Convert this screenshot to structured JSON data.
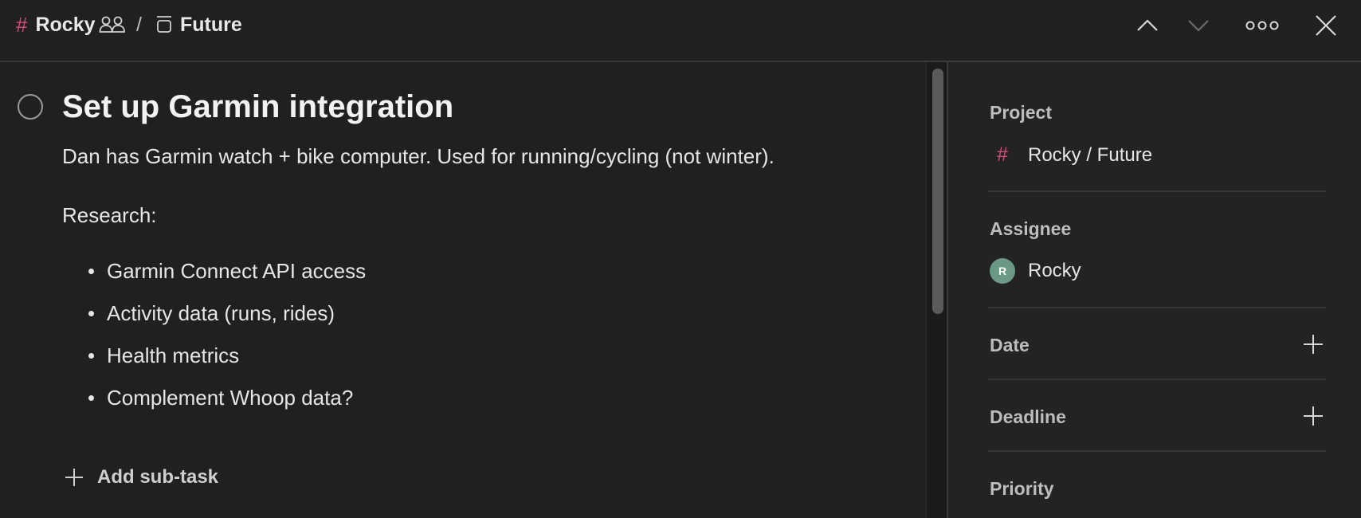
{
  "header": {
    "project_hash": "#",
    "project_name": "Rocky",
    "separator": "/",
    "section_name": "Future",
    "icons": [
      "shared-people-icon",
      "section-icon",
      "chevron-up-icon",
      "chevron-down-icon",
      "more-icon",
      "close-icon"
    ]
  },
  "task": {
    "title": "Set up Garmin integration",
    "description": "Dan has Garmin watch + bike computer. Used for running/cycling (not winter).",
    "research_label": "Research:",
    "bullets": [
      "Garmin Connect API access",
      "Activity data (runs, rides)",
      "Health metrics",
      "Complement Whoop data?"
    ],
    "add_subtask_label": "Add sub-task"
  },
  "sidebar": {
    "project_label": "Project",
    "project_hash": "#",
    "project_value": "Rocky / Future",
    "assignee_label": "Assignee",
    "assignee_initial": "R",
    "assignee_name": "Rocky",
    "date_label": "Date",
    "deadline_label": "Deadline",
    "priority_label": "Priority"
  },
  "colors": {
    "background": "#202020",
    "accent_hash": "#d44c7a",
    "avatar": "#6a9a86"
  }
}
